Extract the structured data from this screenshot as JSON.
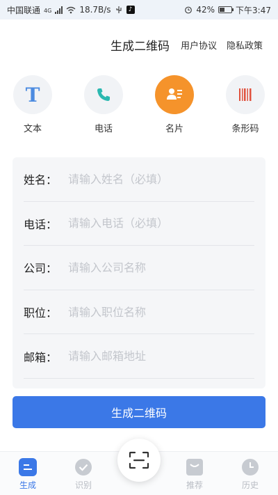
{
  "status_bar": {
    "carrier": "中国联通",
    "network": "4G",
    "speed": "18.7B/s",
    "battery": "42%",
    "battery_level": 0.42,
    "time": "下午3:47"
  },
  "header": {
    "title": "生成二维码",
    "user_agreement": "用户协议",
    "privacy_policy": "隐私政策"
  },
  "types": [
    {
      "label": "文本",
      "icon": "text-icon",
      "active": false
    },
    {
      "label": "电话",
      "icon": "phone-icon",
      "active": false
    },
    {
      "label": "名片",
      "icon": "card-icon",
      "active": true
    },
    {
      "label": "条形码",
      "icon": "barcode-icon",
      "active": false
    }
  ],
  "form": {
    "fields": [
      {
        "label": "姓名：",
        "placeholder": "请输入姓名（必填）"
      },
      {
        "label": "电话：",
        "placeholder": "请输入电话（必填）"
      },
      {
        "label": "公司：",
        "placeholder": "请输入公司名称"
      },
      {
        "label": "职位：",
        "placeholder": "请输入职位名称"
      },
      {
        "label": "邮箱：",
        "placeholder": "请输入邮箱地址"
      }
    ],
    "submit_label": "生成二维码"
  },
  "bottom_nav": {
    "items": [
      {
        "label": "生成",
        "icon": "generate-icon",
        "active": true
      },
      {
        "label": "识别",
        "icon": "recognize-icon",
        "active": false
      },
      {
        "label": "推荐",
        "icon": "recommend-icon",
        "active": false
      },
      {
        "label": "历史",
        "icon": "history-icon",
        "active": false
      }
    ],
    "scan_icon": "scan-icon"
  },
  "colors": {
    "accent": "#3b78e7",
    "active_type": "#f5932b",
    "status_bar_bg": "#eef3f9",
    "card_bg": "#f5f6f8"
  }
}
